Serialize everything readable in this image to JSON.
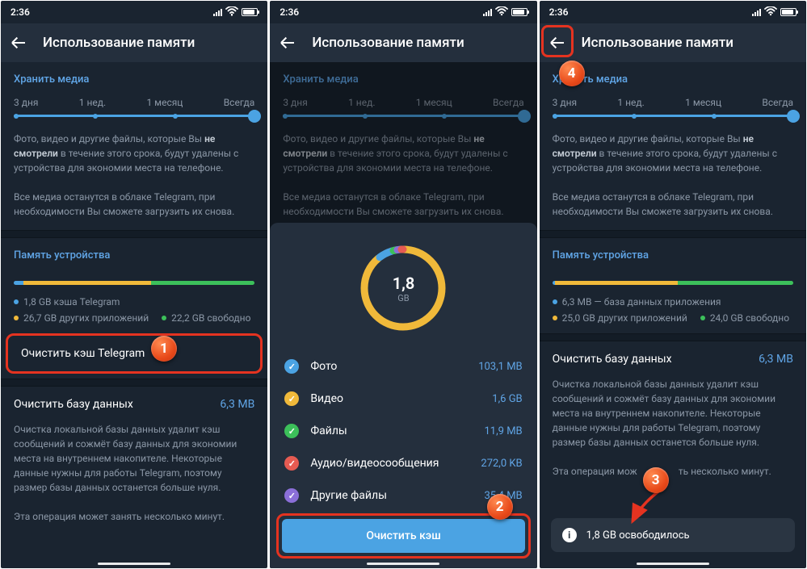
{
  "status": {
    "time": "2:36"
  },
  "header": {
    "title": "Использование памяти"
  },
  "media": {
    "section_title": "Хранить медиа",
    "opts": [
      "3 дня",
      "1 нед.",
      "1 месяц",
      "Всегда"
    ],
    "desc1_a": "Фото, видео и другие файлы, которые Вы ",
    "desc1_b": "не смотрели",
    "desc1_c": " в течение этого срока, будут удалены с устройства для экономии места на телефоне.",
    "desc2": "Все медиа останутся в облаке Telegram, при необходимости Вы сможете загрузить их снова."
  },
  "storage_title": "Память устройства",
  "s1": {
    "leg1": "1,8 GB кэша Telegram",
    "leg2": "26,7 GB других приложений",
    "leg3": "22,2 GB свободно",
    "clear_cache": "Очистить кэш Telegram",
    "clear_db": "Очистить базу данных",
    "db_size": "6,3 MB",
    "db_desc": "Очистка локальной базы данных удалит кэш сообщений и сожмёт базу данных для экономии места на внутреннем накопителе. Некоторые данные нужны для работы Telegram, поэтому размер базы данных останется больше нуля.",
    "op_time": "Эта операция может занять несколько минут."
  },
  "s2": {
    "total": "1,8",
    "unit": "GB",
    "cats": [
      {
        "label": "Фото",
        "size": "103,1 MB",
        "color": "#4ba3e3"
      },
      {
        "label": "Видео",
        "size": "1,6 GB",
        "color": "#f0b93a"
      },
      {
        "label": "Файлы",
        "size": "11,9 MB",
        "color": "#3cc05a"
      },
      {
        "label": "Аудио/видеосообщения",
        "size": "272,0 KB",
        "color": "#e65b52"
      },
      {
        "label": "Другие файлы",
        "size": "35,4 MB",
        "color": "#8b6fd8"
      }
    ],
    "button": "Очистить кэш"
  },
  "s3": {
    "leg1": "6,3 MB — база данных приложения",
    "leg2": "25,0 GB других приложений",
    "leg3": "24,0 GB свободно",
    "clear_db": "Очистить базу данных",
    "db_size": "6,3 MB",
    "db_desc": "Очистка локальной базы данных удалит кэш сообщений и сожмёт базу данных для экономии места на внутреннем накопителе. Некоторые данные нужны для работы Telegram, поэтому размер базы данных останется больше нуля.",
    "op_time_a": "Эта операция мож",
    "op_time_b": "ть несколько минут.",
    "toast": "1,8 GB освободилось"
  },
  "callouts": {
    "c1": "1",
    "c2": "2",
    "c3": "3",
    "c4": "4"
  }
}
